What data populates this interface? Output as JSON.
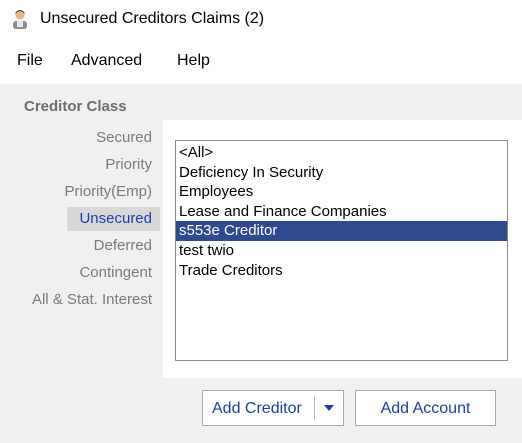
{
  "window": {
    "title": "Unsecured Creditors Claims (2)",
    "icon": "person-icon"
  },
  "menu": {
    "items": [
      {
        "label": "File"
      },
      {
        "label": "Advanced"
      },
      {
        "label": "Help"
      }
    ]
  },
  "creditor_class": {
    "heading": "Creditor Class",
    "items": [
      {
        "label": "Secured"
      },
      {
        "label": "Priority"
      },
      {
        "label": "Priority(Emp)"
      },
      {
        "label": "Unsecured",
        "selected": true
      },
      {
        "label": "Deferred"
      },
      {
        "label": "Contingent"
      },
      {
        "label": "All & Stat. Interest"
      }
    ]
  },
  "creditor_list": {
    "items": [
      {
        "label": "<All>"
      },
      {
        "label": "Deficiency In Security"
      },
      {
        "label": "Employees"
      },
      {
        "label": "Lease and Finance Companies"
      },
      {
        "label": "s553e Creditor",
        "selected": true
      },
      {
        "label": "test twio"
      },
      {
        "label": "Trade Creditors"
      }
    ]
  },
  "buttons": {
    "add_creditor": "Add Creditor",
    "add_creditor_dropdown_icon": "caret-down-icon",
    "add_account": "Add Account"
  },
  "colors": {
    "accent_text": "#1b3fae",
    "selection_bg": "#2f4b8f",
    "panel_bg": "#f0f0f0"
  }
}
